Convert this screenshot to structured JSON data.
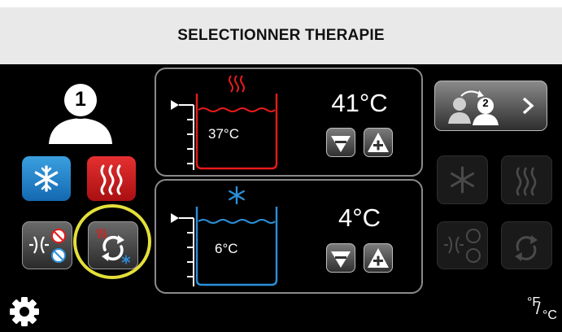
{
  "header": {
    "title": "SELECTIONNER THERAPIE"
  },
  "patient": {
    "number": "1",
    "next_number": "2"
  },
  "hot_tank": {
    "setpoint": "41°C",
    "current": "37°C",
    "color": "#e51b1b"
  },
  "cold_tank": {
    "setpoint": "4°C",
    "current": "6°C",
    "color": "#2b8fd9"
  },
  "footer": {
    "unit_toggle": {
      "f": "°F",
      "slash": "/",
      "c": "°C"
    }
  },
  "colors": {
    "highlight": "#e3df3a",
    "cold_tile": "#1f86c8",
    "hot_tile": "#d8181b",
    "panel_border": "#8a8a8a"
  },
  "icons": [
    "settings-gear-icon",
    "snowflake-icon",
    "heat-waves-icon",
    "contrast-icon",
    "cycle-icon",
    "switch-patient-icon",
    "chevron-right-icon",
    "minus-icon",
    "plus-icon",
    "patient-icon"
  ]
}
